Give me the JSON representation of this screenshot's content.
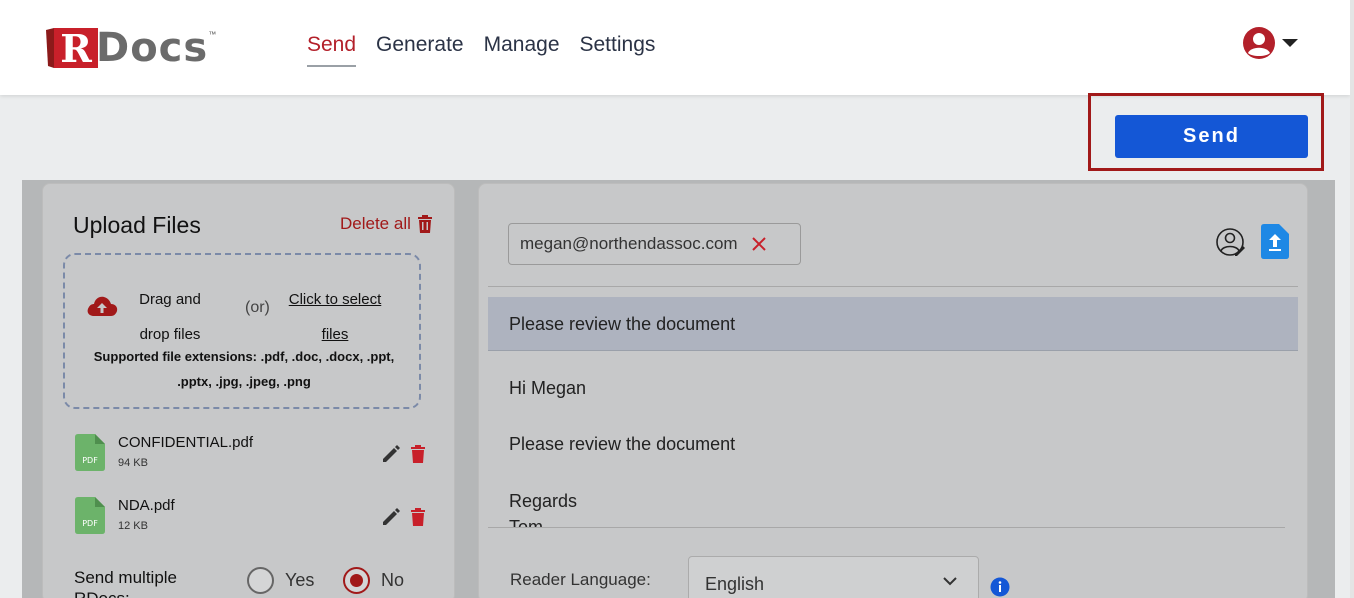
{
  "brand": {
    "logo_letter": "R",
    "logo_text": "Docs",
    "trademark": "™"
  },
  "nav": [
    {
      "label": "Send",
      "active": true
    },
    {
      "label": "Generate",
      "active": false
    },
    {
      "label": "Manage",
      "active": false
    },
    {
      "label": "Settings",
      "active": false
    }
  ],
  "toolbar": {
    "send_label": "Send"
  },
  "upload": {
    "title": "Upload Files",
    "delete_all_label": "Delete all",
    "drag_text": "Drag and drop files",
    "or_text": "(or)",
    "click_text": "Click to select files",
    "supported_text": "Supported file extensions: .pdf, .doc, .docx, .ppt, .pptx, .jpg, .jpeg, .png",
    "files": [
      {
        "name": "CONFIDENTIAL.pdf",
        "size": "94 KB",
        "icon_label": "PDF"
      },
      {
        "name": "NDA.pdf",
        "size": "12 KB",
        "icon_label": "PDF"
      }
    ],
    "multiple_label": "Send multiple RDocs:",
    "options": [
      {
        "label": "Yes",
        "checked": false
      },
      {
        "label": "No",
        "checked": true
      }
    ]
  },
  "message": {
    "recipient": "megan@northendassoc.com",
    "subject": "Please review the document",
    "body": [
      "Hi Megan",
      "Please review the document",
      "Regards",
      "Tom"
    ],
    "reader_language_label": "Reader Language:",
    "reader_language_value": "English"
  },
  "colors": {
    "brand_red": "#a11919",
    "primary_blue": "#1457d6",
    "nav_text": "#2b3346"
  }
}
